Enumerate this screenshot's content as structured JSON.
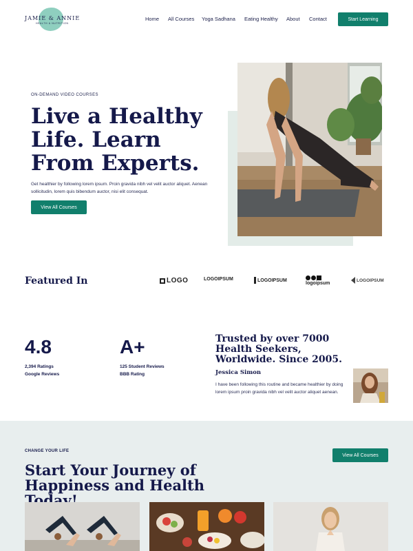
{
  "brand": {
    "name": "JAMIE & ANNIE",
    "tagline": "HEALTH & NUTRITION",
    "accent": "#117f6c",
    "navy": "#15194a",
    "blob": "#8fcfbf"
  },
  "nav": {
    "items": [
      "Home",
      "All Courses",
      "Yoga Sadhana",
      "Eating Healthy",
      "About",
      "Contact"
    ],
    "cta": "Start Learning"
  },
  "hero": {
    "eyebrow": "ON-DEMAND VIDEO COURSES",
    "title": "Live a Healthy Life. Learn From Experts.",
    "text": "Get healthier by following lorem ipsum. Proin gravida nibh vel velit auctor aliquet. Aenean sollicitudin, lorem quis bibendum auctor, nisi elit consequat.",
    "button": "View All Courses"
  },
  "featured": {
    "title": "Featured In",
    "logos": [
      "LOGO",
      "LOGOIPSUM",
      "LOGOIPSUM",
      "logoipsum",
      "LOGOIPSUM"
    ]
  },
  "stats": {
    "rating": {
      "value": "4.8",
      "line1": "2,394 Ratings",
      "line2": "Google Reviews"
    },
    "grade": {
      "value": "A+",
      "line1": "125 Student Reviews",
      "line2": "BBB Rating"
    }
  },
  "testimonial": {
    "title": "Trusted by over 7000 Health Seekers, Worldwide. Since 2005.",
    "name": "Jessica Simon",
    "text": "I have been following this routine and became healthier by doing lorem ipsum proin gravida nibh vel velit auctor aliquet aenean."
  },
  "journey": {
    "eyebrow": "CHANGE YOUR LIFE",
    "title": "Start Your Journey of Happiness and Health Today!",
    "button": "View All Courses"
  }
}
